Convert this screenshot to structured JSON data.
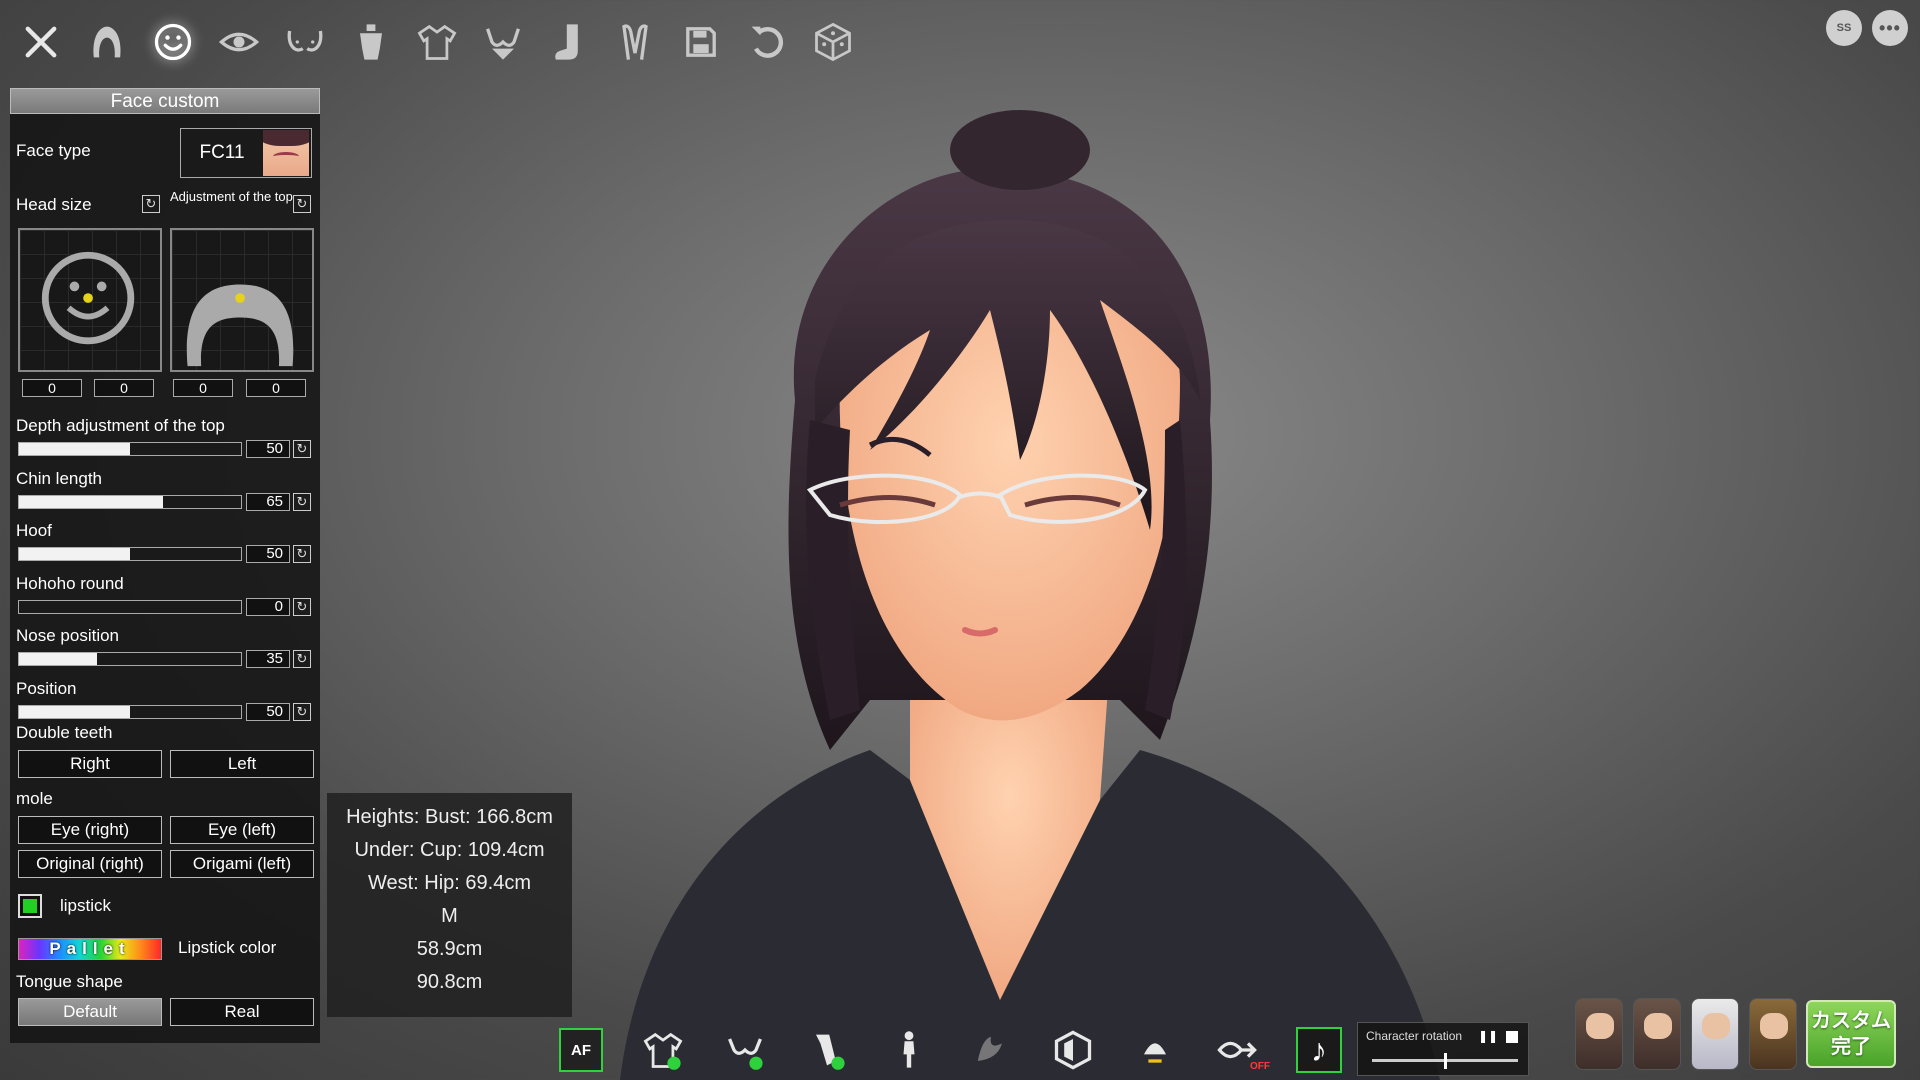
{
  "panel": {
    "title": "Face custom",
    "face_type_label": "Face type",
    "face_type_value": "FC11",
    "head_size_label": "Head size",
    "adjust_top_label": "Adjustment of the top",
    "head_size_values": [
      "0",
      "0"
    ],
    "adjust_top_values": [
      "0",
      "0"
    ],
    "sliders": [
      {
        "label": "Depth adjustment of the top",
        "value": "50",
        "fill": 0.5
      },
      {
        "label": "Chin length",
        "value": "65",
        "fill": 0.65
      },
      {
        "label": "Hoof",
        "value": "50",
        "fill": 0.5
      },
      {
        "label": "Hohoho round",
        "value": "0",
        "fill": 0.0
      },
      {
        "label": "Nose position",
        "value": "35",
        "fill": 0.35
      },
      {
        "label": "Position",
        "value": "50",
        "fill": 0.5
      }
    ],
    "double_teeth_label": "Double teeth",
    "double_teeth_right": "Right",
    "double_teeth_left": "Left",
    "mole_label": "mole",
    "mole_eye_right": "Eye (right)",
    "mole_eye_left": "Eye (left)",
    "mole_orig_right": "Original (right)",
    "mole_origami_left": "Origami (left)",
    "lipstick_label": "lipstick",
    "lipstick_checked": true,
    "pallet_label": "Pallet",
    "lipstick_color_label": "Lipstick color",
    "tongue_label": "Tongue shape",
    "tongue_default": "Default",
    "tongue_real": "Real"
  },
  "stats": {
    "line1": "Heights: Bust: 166.8cm",
    "line2": "Under: Cup: 109.4cm",
    "line3": "West: Hip: 69.4cm",
    "line4": "M",
    "line5": "58.9cm",
    "line6": "90.8cm"
  },
  "toolbar": {
    "icons": [
      "close-icon",
      "hair-icon",
      "face-icon",
      "eye-icon",
      "chest-icon",
      "body-icon",
      "top-clothes-icon",
      "bra-icon",
      "sock-icon",
      "accessory-bunny-icon",
      "save-icon",
      "undo-icon",
      "random-dice-icon"
    ],
    "active": "face-icon"
  },
  "top_right": {
    "screenshot_label": "SS"
  },
  "bottom": {
    "af_label": "AF",
    "rotation_label": "Character rotation",
    "off_label": "OFF",
    "finish_label_line1": "カスタム",
    "finish_label_line2": "完了"
  },
  "colors": {
    "accent_green": "#2fd23c",
    "lipstick_swatch": "#22d024"
  }
}
